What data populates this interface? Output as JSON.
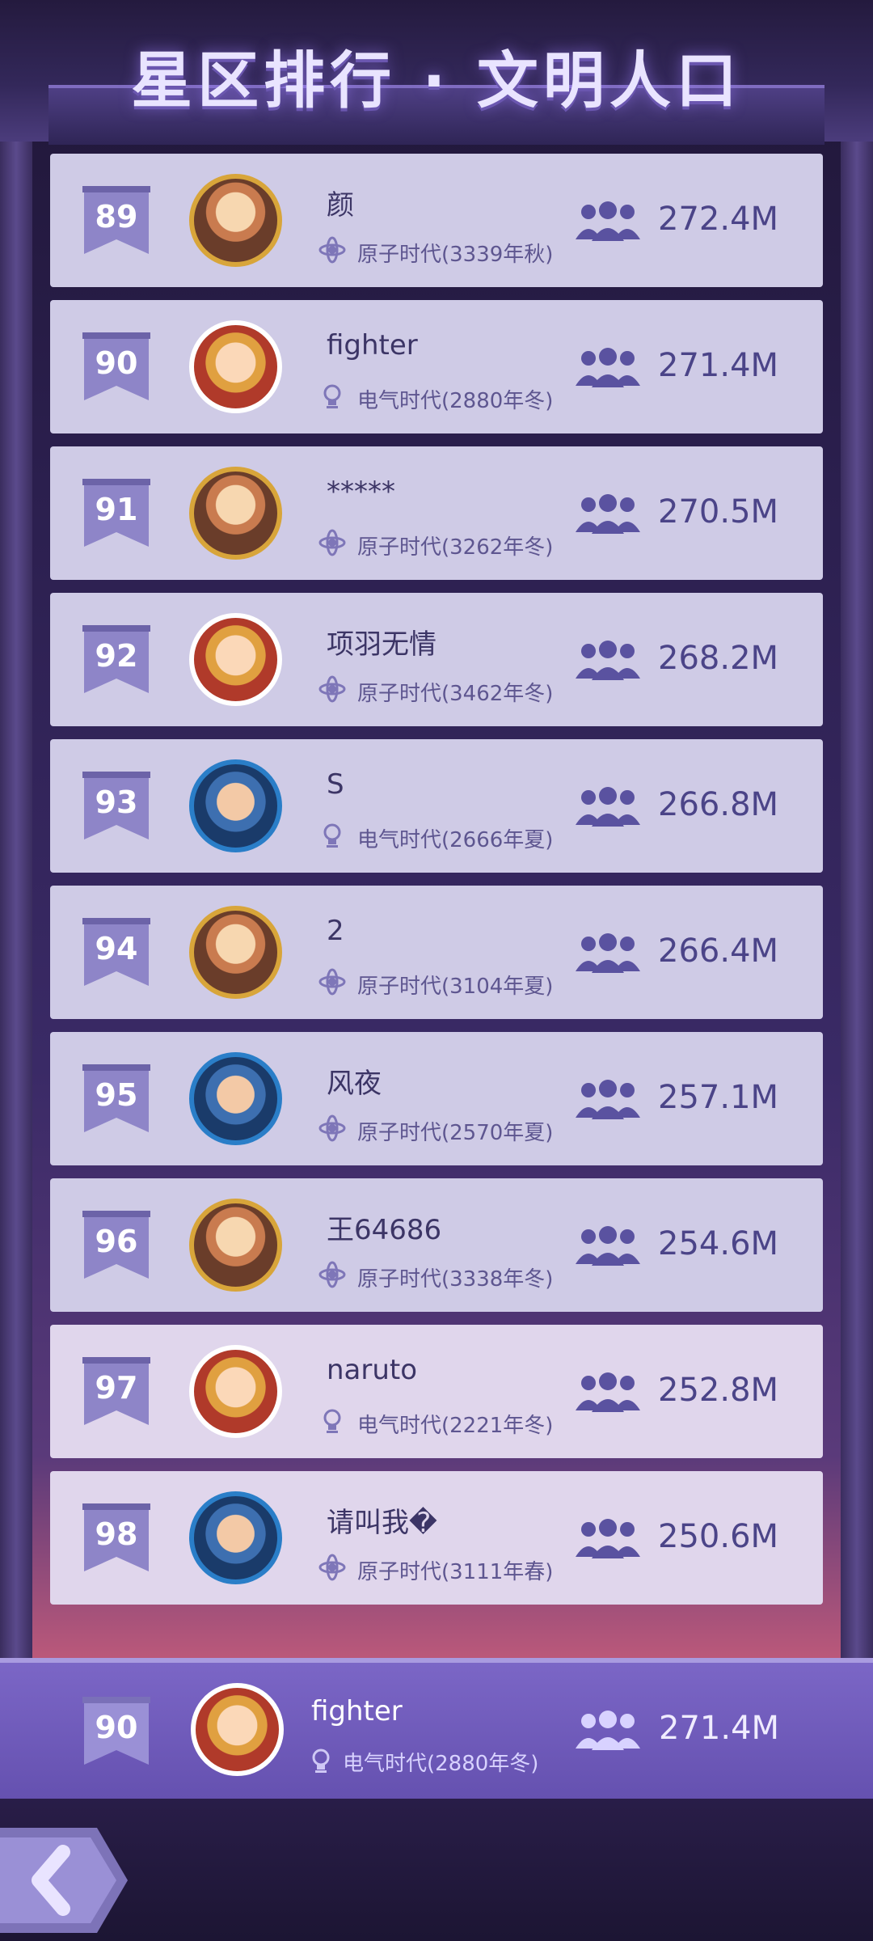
{
  "header": {
    "title": "星区排行 · 文明人口"
  },
  "rows": [
    {
      "rank": "89",
      "name": "颜",
      "era": "原子时代(3339年秋)",
      "population": "272.4M"
    },
    {
      "rank": "90",
      "name": "fighter",
      "era": "电气时代(2880年冬)",
      "population": "271.4M"
    },
    {
      "rank": "91",
      "name": "*****",
      "era": "原子时代(3262年冬)",
      "population": "270.5M"
    },
    {
      "rank": "92",
      "name": "项羽无情",
      "era": "原子时代(3462年冬)",
      "population": "268.2M"
    },
    {
      "rank": "93",
      "name": "S",
      "era": "电气时代(2666年夏)",
      "population": "266.8M"
    },
    {
      "rank": "94",
      "name": "2",
      "era": "原子时代(3104年夏)",
      "population": "266.4M"
    },
    {
      "rank": "95",
      "name": "风夜",
      "era": "原子时代(2570年夏)",
      "population": "257.1M"
    },
    {
      "rank": "96",
      "name": "王64686",
      "era": "原子时代(3338年冬)",
      "population": "254.6M"
    },
    {
      "rank": "97",
      "name": "naruto",
      "era": "电气时代(2221年冬)",
      "population": "252.8M"
    },
    {
      "rank": "98",
      "name": "请叫我�",
      "era": "原子时代(3111年春)",
      "population": "250.6M"
    }
  ],
  "self": {
    "rank": "90",
    "name": "fighter",
    "era": "电气时代(2880年冬)",
    "population": "271.4M"
  },
  "icons": {
    "back": "back-arrow-icon",
    "population": "people-icon",
    "atomic_era": "atom-icon",
    "electric_era": "bulb-icon"
  },
  "colors": {
    "row_bg": "#cfcbe6",
    "accent": "#4b4488",
    "self_bg": "#6551b0"
  }
}
